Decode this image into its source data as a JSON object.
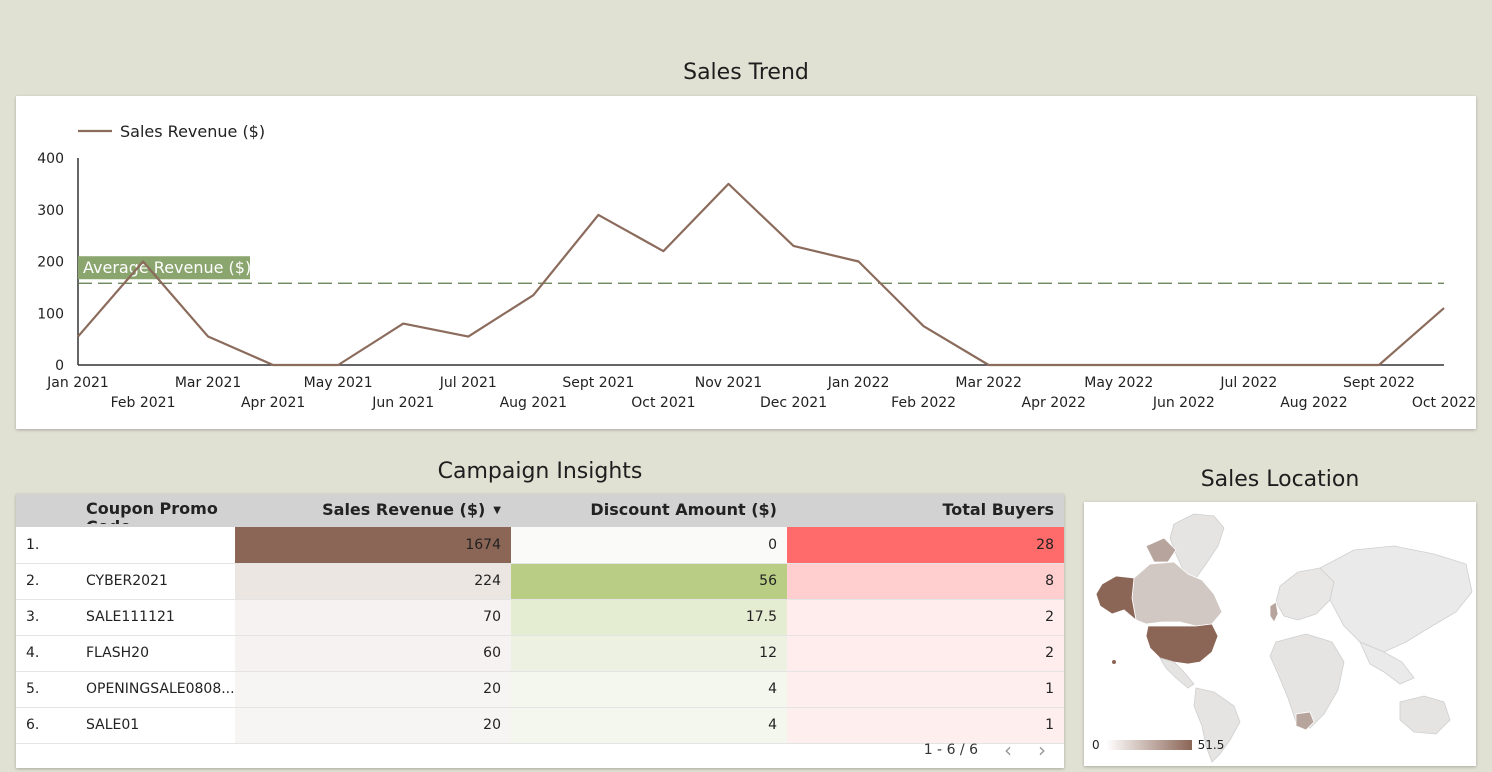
{
  "trend": {
    "title": "Sales Trend",
    "chart_data": {
      "type": "line",
      "series": [
        {
          "name": "Sales Revenue ($)",
          "color": "#8b6b5c",
          "x": [
            "Jan 2021",
            "Feb 2021",
            "Mar 2021",
            "Apr 2021",
            "May 2021",
            "Jun 2021",
            "Jul 2021",
            "Aug 2021",
            "Sept 2021",
            "Oct 2021",
            "Nov 2021",
            "Dec 2021",
            "Jan 2022",
            "Feb 2022",
            "Mar 2022",
            "Apr 2022",
            "May 2022",
            "Jun 2022",
            "Jul 2022",
            "Aug 2022",
            "Sept 2022",
            "Oct 2022"
          ],
          "values": [
            55,
            200,
            55,
            0,
            0,
            80,
            55,
            135,
            290,
            220,
            350,
            230,
            200,
            75,
            0,
            0,
            0,
            0,
            0,
            0,
            0,
            110
          ]
        }
      ],
      "reference_line": {
        "label": "Average Revenue ($)",
        "value": 158,
        "color": "#5f7a4a",
        "label_bg": "#8aa56e"
      },
      "y_ticks": [
        "0",
        "100",
        "200",
        "300",
        "400"
      ],
      "ylim": [
        0,
        400
      ],
      "legend_position": "top-left"
    }
  },
  "table": {
    "title": "Campaign Insights",
    "columns": [
      "Coupon Promo Code",
      "Sales Revenue ($)",
      "Discount Amount ($)",
      "Total Buyers"
    ],
    "rows": [
      {
        "idx": "1.",
        "code": "",
        "revenue": "1674",
        "discount": "0",
        "buyers": "28",
        "rev_bg": "#8b6556",
        "disc_bg": "#fafaf8",
        "buy_bg": "#ff6b6b"
      },
      {
        "idx": "2.",
        "code": "CYBER2021",
        "revenue": "224",
        "discount": "56",
        "buyers": "8",
        "rev_bg": "#ece6e3",
        "disc_bg": "#b9ce84",
        "buy_bg": "#ffcfcf"
      },
      {
        "idx": "3.",
        "code": "SALE111121",
        "revenue": "70",
        "discount": "17.5",
        "buyers": "2",
        "rev_bg": "#f5f2f1",
        "disc_bg": "#e4ecd2",
        "buy_bg": "#ffeded"
      },
      {
        "idx": "4.",
        "code": "FLASH20",
        "revenue": "60",
        "discount": "12",
        "buyers": "2",
        "rev_bg": "#f5f2f1",
        "disc_bg": "#ecf1e1",
        "buy_bg": "#ffeded"
      },
      {
        "idx": "5.",
        "code": "OPENINGSALE0808...",
        "revenue": "20",
        "discount": "4",
        "buyers": "1",
        "rev_bg": "#f6f5f3",
        "disc_bg": "#f4f7ed",
        "buy_bg": "#ffeeee"
      },
      {
        "idx": "6.",
        "code": "SALE01",
        "revenue": "20",
        "discount": "4",
        "buyers": "1",
        "rev_bg": "#f6f5f3",
        "disc_bg": "#f4f7ed",
        "buy_bg": "#ffeeee"
      }
    ],
    "pagination": "1 - 6 / 6",
    "prev_icon": "chevron-left-icon",
    "next_icon": "chevron-right-icon"
  },
  "map": {
    "title": "Sales Location",
    "legend_min": "0",
    "legend_max": "51.5",
    "color_low": "#ffffff",
    "color_high": "#8b6556"
  }
}
